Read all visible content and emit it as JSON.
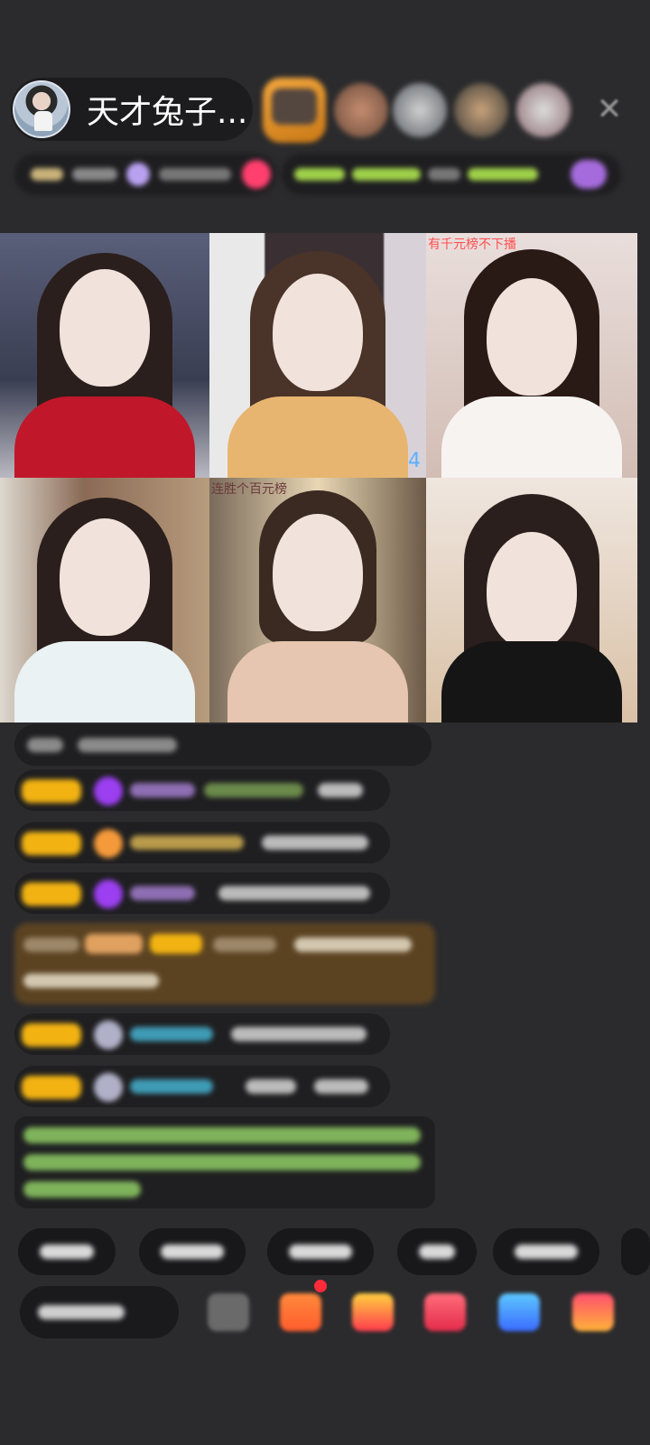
{
  "header": {
    "host_name": "天才兔子...",
    "close_symbol": "✕",
    "viewers": [
      "viewer-1",
      "viewer-2",
      "viewer-3",
      "viewer-4",
      "viewer-5"
    ]
  },
  "grid": {
    "tiles": [
      {
        "overlay": ""
      },
      {
        "overlay": "4"
      },
      {
        "overlay": "有千元榜不下播"
      },
      {
        "overlay": ""
      },
      {
        "overlay": "连胜个百元榜"
      },
      {
        "overlay": ""
      }
    ]
  },
  "colors": {
    "badge": "#f2b312",
    "gem_purple": "#9b3ff0",
    "gem_orange": "#f59a3a",
    "name_cyan": "#3f9bb5",
    "system_green": "#7fb35b"
  }
}
